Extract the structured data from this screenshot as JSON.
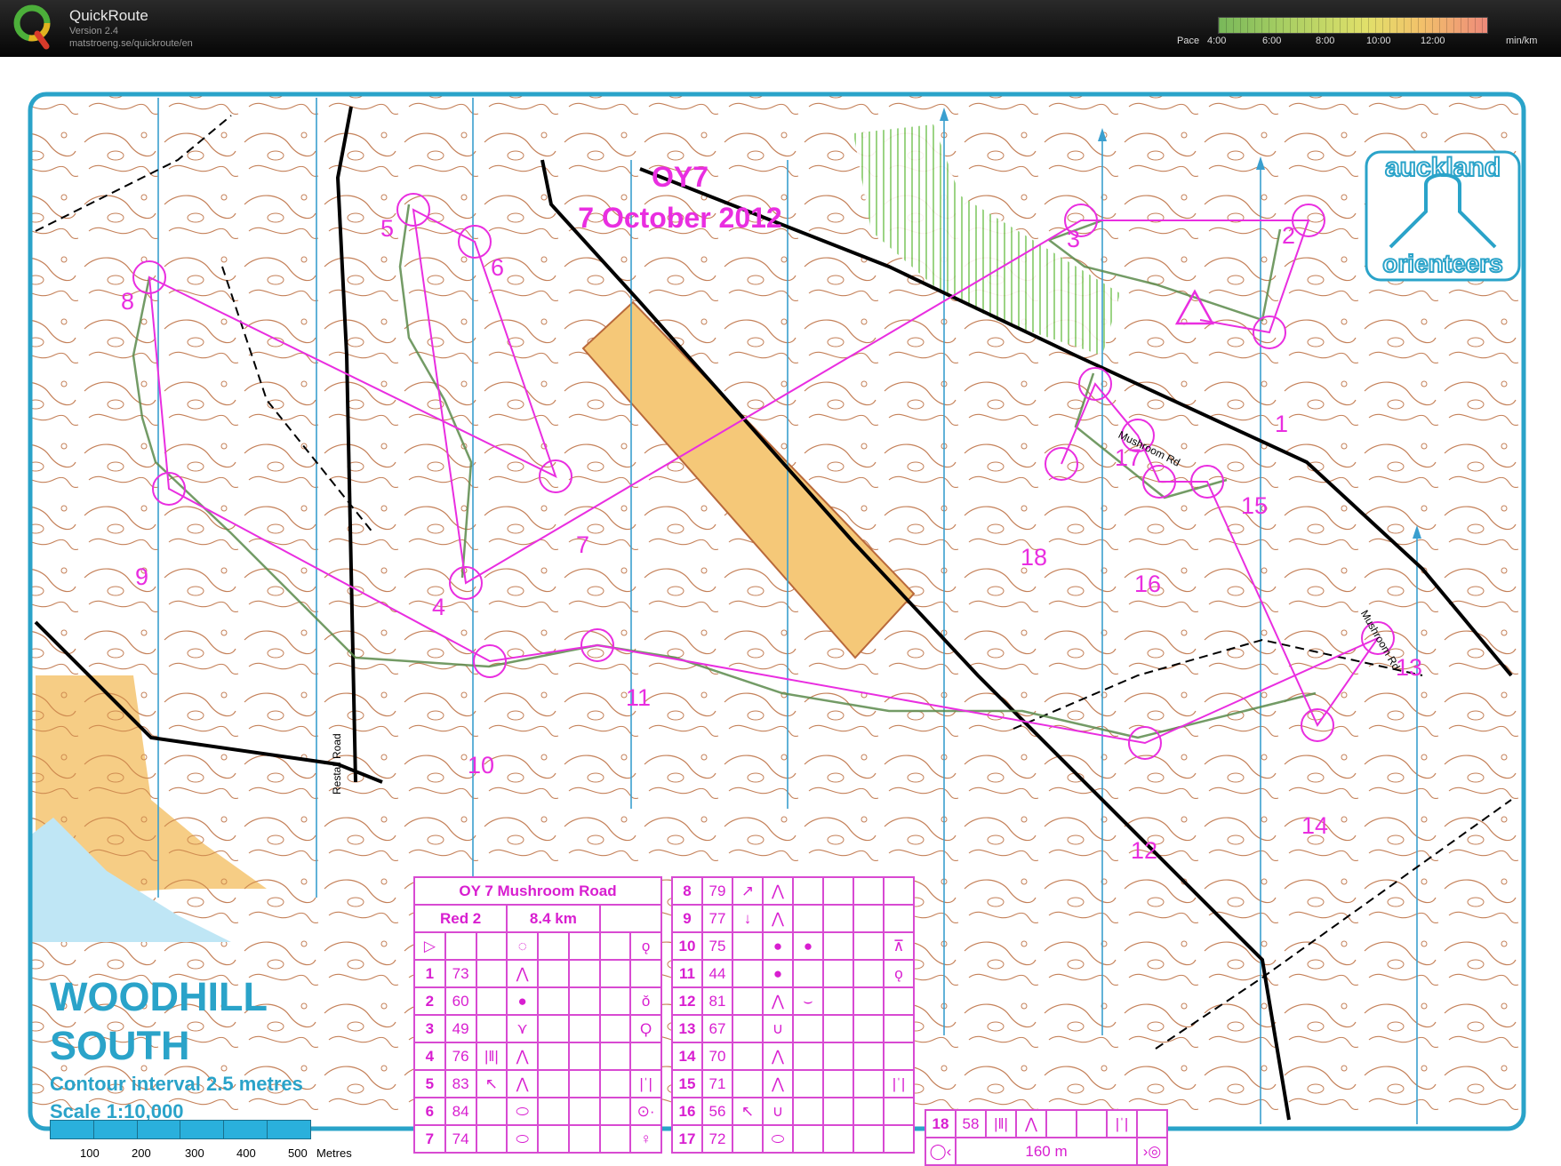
{
  "app": {
    "name": "QuickRoute",
    "version": "Version 2.4",
    "url": "matstroeng.se/quickroute/en"
  },
  "pace": {
    "label": "Pace",
    "ticks": [
      "4:00",
      "6:00",
      "8:00",
      "10:00",
      "12:00"
    ],
    "unit": "min/km",
    "colors": [
      "#78b85a",
      "#a9cf63",
      "#e1e06a",
      "#f2c26a",
      "#ee8a7a"
    ]
  },
  "event": {
    "title": "OY7",
    "date": "7 October 2012"
  },
  "club": {
    "line1": "auckland",
    "line2": "orienteers"
  },
  "map": {
    "name_line1": "WOODHILL",
    "name_line2": "SOUTH",
    "contour": "Contour interval 2.5 metres",
    "scale": "Scale 1:10,000",
    "scale_ticks": [
      "100",
      "200",
      "300",
      "400",
      "500"
    ],
    "scale_unit": "Metres",
    "road1": "Restall Road",
    "road2": "Mushroom Rd",
    "road3": "Mushroom Rd",
    "colors": {
      "course": "#e92ee0",
      "route": "#5b8a4b",
      "north_lines": "#3a9fcf",
      "frame": "#2aa3c9",
      "forest_open": "#f5c878"
    }
  },
  "controls": [
    "1",
    "2",
    "3",
    "4",
    "5",
    "6",
    "7",
    "8",
    "9",
    "10",
    "11",
    "12",
    "13",
    "14",
    "15",
    "16",
    "17",
    "18"
  ],
  "descriptions": {
    "header": "OY 7 Mushroom Road",
    "course": "Red 2",
    "length": "8.4 km",
    "finish_distance": "160 m",
    "left": [
      {
        "n": "1",
        "code": "73",
        "feature": "⋀"
      },
      {
        "n": "2",
        "code": "60",
        "feature": "●",
        "extra": "ǒ"
      },
      {
        "n": "3",
        "code": "49",
        "feature": "⋎",
        "extra": "Ϙ"
      },
      {
        "n": "4",
        "code": "76",
        "col": "|‖|",
        "feature": "⋀"
      },
      {
        "n": "5",
        "code": "83",
        "col": "↖",
        "feature": "⋀",
        "extra": "|ˈ|"
      },
      {
        "n": "6",
        "code": "84",
        "feature": "⬭",
        "extra": "⊙·"
      },
      {
        "n": "7",
        "code": "74",
        "feature": "⬭",
        "extra": "♀"
      }
    ],
    "right": [
      {
        "n": "8",
        "code": "79",
        "col": "↗",
        "feature": "⋀"
      },
      {
        "n": "9",
        "code": "77",
        "col": "↓",
        "feature": "⋀"
      },
      {
        "n": "10",
        "code": "75",
        "feature": "●",
        "f2": "●",
        "extra": "⊼"
      },
      {
        "n": "11",
        "code": "44",
        "feature": "●",
        "extra": "ǫ"
      },
      {
        "n": "12",
        "code": "81",
        "feature": "⋀",
        "f2": "⌣"
      },
      {
        "n": "13",
        "code": "67",
        "feature": "∪"
      },
      {
        "n": "14",
        "code": "70",
        "feature": "⋀"
      },
      {
        "n": "15",
        "code": "71",
        "feature": "⋀",
        "extra": "|ˈ|"
      },
      {
        "n": "16",
        "code": "56",
        "col": "↖",
        "feature": "∪"
      },
      {
        "n": "17",
        "code": "72",
        "feature": "⬭"
      }
    ],
    "last": {
      "n": "18",
      "code": "58",
      "col": "|‖|",
      "feature": "⋀",
      "extra": "|ˈ|"
    }
  }
}
